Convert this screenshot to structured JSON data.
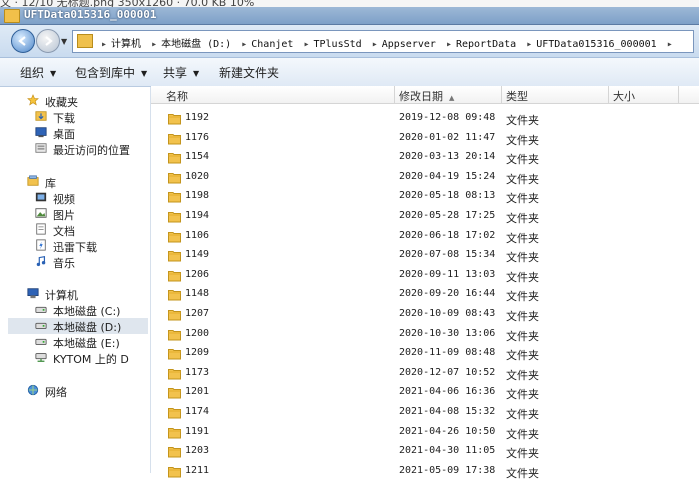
{
  "top_strip_text": "文 · 12/10 无标题.png  350x1260  ·  70.0 KB  10%",
  "window": {
    "title": "UFTData015316_000001"
  },
  "address": {
    "crumbs": [
      "计算机",
      "本地磁盘 (D:)",
      "Chanjet",
      "TPlusStd",
      "Appserver",
      "ReportData",
      "UFTData015316_000001"
    ]
  },
  "toolbar": {
    "organize": "组织",
    "include_library": "包含到库中",
    "share": "共享",
    "new_folder": "新建文件夹"
  },
  "navpane": {
    "favorites": {
      "label": "收藏夹",
      "icon": "star-icon",
      "items": [
        {
          "label": "下载",
          "icon": "download-folder-icon"
        },
        {
          "label": "桌面",
          "icon": "desktop-icon"
        },
        {
          "label": "最近访问的位置",
          "icon": "recent-places-icon"
        }
      ]
    },
    "libraries": {
      "label": "库",
      "icon": "library-icon",
      "items": [
        {
          "label": "视频",
          "icon": "video-icon"
        },
        {
          "label": "图片",
          "icon": "pictures-icon"
        },
        {
          "label": "文档",
          "icon": "documents-icon"
        },
        {
          "label": "迅雷下载",
          "icon": "thunder-download-icon"
        },
        {
          "label": "音乐",
          "icon": "music-icon"
        }
      ]
    },
    "computer": {
      "label": "计算机",
      "icon": "computer-icon",
      "items": [
        {
          "label": "本地磁盘 (C:)",
          "icon": "drive-icon"
        },
        {
          "label": "本地磁盘 (D:)",
          "icon": "drive-icon",
          "selected": true
        },
        {
          "label": "本地磁盘 (E:)",
          "icon": "drive-icon"
        },
        {
          "label": "KYTOM 上的 D",
          "icon": "network-drive-icon"
        }
      ]
    },
    "network": {
      "label": "网络",
      "icon": "network-icon"
    }
  },
  "columns": {
    "name": "名称",
    "modified": "修改日期",
    "type": "类型",
    "size": "大小"
  },
  "files": [
    {
      "name": "1192",
      "date": "2019-12-08 09:48",
      "type": "文件夹"
    },
    {
      "name": "1176",
      "date": "2020-01-02 11:47",
      "type": "文件夹"
    },
    {
      "name": "1154",
      "date": "2020-03-13 20:14",
      "type": "文件夹"
    },
    {
      "name": "1020",
      "date": "2020-04-19 15:24",
      "type": "文件夹"
    },
    {
      "name": "1198",
      "date": "2020-05-18 08:13",
      "type": "文件夹"
    },
    {
      "name": "1194",
      "date": "2020-05-28 17:25",
      "type": "文件夹"
    },
    {
      "name": "1106",
      "date": "2020-06-18 17:02",
      "type": "文件夹"
    },
    {
      "name": "1149",
      "date": "2020-07-08 15:34",
      "type": "文件夹"
    },
    {
      "name": "1206",
      "date": "2020-09-11 13:03",
      "type": "文件夹"
    },
    {
      "name": "1148",
      "date": "2020-09-20 16:44",
      "type": "文件夹"
    },
    {
      "name": "1207",
      "date": "2020-10-09 08:43",
      "type": "文件夹"
    },
    {
      "name": "1200",
      "date": "2020-10-30 13:06",
      "type": "文件夹"
    },
    {
      "name": "1209",
      "date": "2020-11-09 08:48",
      "type": "文件夹"
    },
    {
      "name": "1173",
      "date": "2020-12-07 10:52",
      "type": "文件夹"
    },
    {
      "name": "1201",
      "date": "2021-04-06 16:36",
      "type": "文件夹"
    },
    {
      "name": "1174",
      "date": "2021-04-08 15:32",
      "type": "文件夹"
    },
    {
      "name": "1191",
      "date": "2021-04-26 10:50",
      "type": "文件夹"
    },
    {
      "name": "1203",
      "date": "2021-04-30 11:05",
      "type": "文件夹"
    },
    {
      "name": "1211",
      "date": "2021-05-09 17:38",
      "type": "文件夹"
    }
  ],
  "colors": {
    "folder": "#f2c24d",
    "folder_border": "#c3941c",
    "selection": "#dfe6ee",
    "titlebar": "#7da0c8"
  }
}
